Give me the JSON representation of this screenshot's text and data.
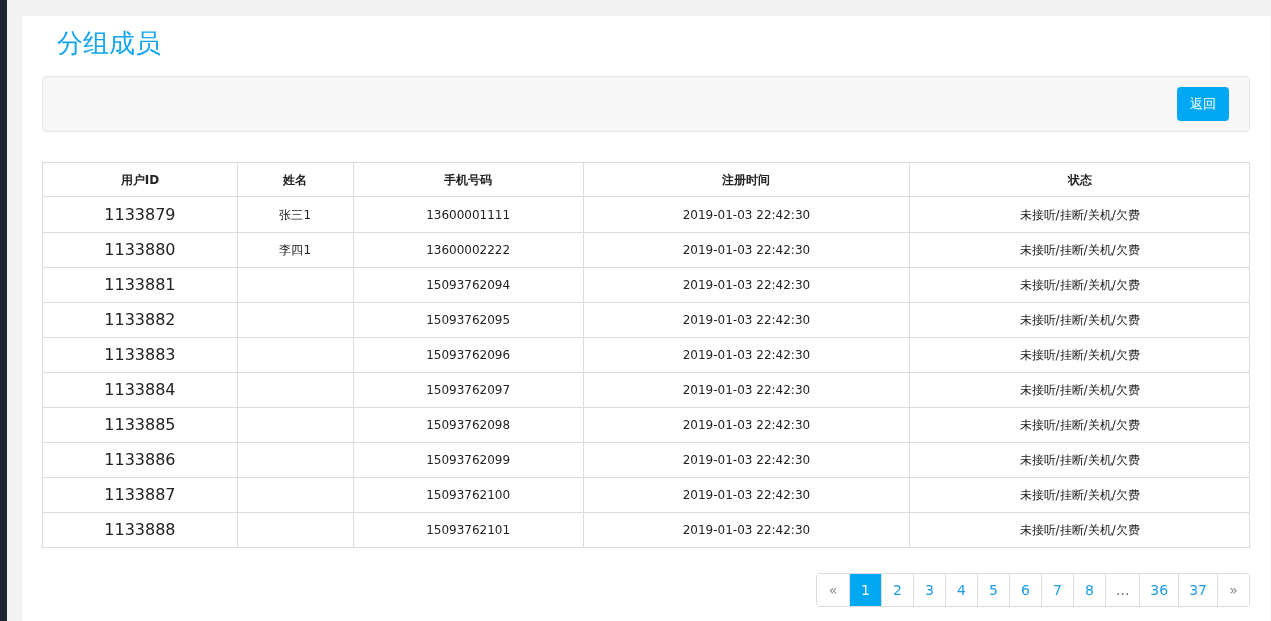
{
  "title": "分组成员",
  "toolbar": {
    "back_button": "返回"
  },
  "table": {
    "columns": [
      "用户ID",
      "姓名",
      "手机号码",
      "注册时间",
      "状态"
    ],
    "rows": [
      {
        "user_id": "1133879",
        "name": "张三1",
        "phone": "13600001111",
        "registered": "2019-01-03 22:42:30",
        "status": "未接听/挂断/关机/欠费"
      },
      {
        "user_id": "1133880",
        "name": "李四1",
        "phone": "13600002222",
        "registered": "2019-01-03 22:42:30",
        "status": "未接听/挂断/关机/欠费"
      },
      {
        "user_id": "1133881",
        "phone": "15093762094",
        "registered": "2019-01-03 22:42:30",
        "status": "未接听/挂断/关机/欠费"
      },
      {
        "user_id": "1133882",
        "phone": "15093762095",
        "registered": "2019-01-03 22:42:30",
        "status": "未接听/挂断/关机/欠费"
      },
      {
        "user_id": "1133883",
        "phone": "15093762096",
        "registered": "2019-01-03 22:42:30",
        "status": "未接听/挂断/关机/欠费"
      },
      {
        "user_id": "1133884",
        "phone": "15093762097",
        "registered": "2019-01-03 22:42:30",
        "status": "未接听/挂断/关机/欠费"
      },
      {
        "user_id": "1133885",
        "phone": "15093762098",
        "registered": "2019-01-03 22:42:30",
        "status": "未接听/挂断/关机/欠费"
      },
      {
        "user_id": "1133886",
        "phone": "15093762099",
        "registered": "2019-01-03 22:42:30",
        "status": "未接听/挂断/关机/欠费"
      },
      {
        "user_id": "1133887",
        "phone": "15093762100",
        "registered": "2019-01-03 22:42:30",
        "status": "未接听/挂断/关机/欠费"
      },
      {
        "user_id": "1133888",
        "phone": "15093762101",
        "registered": "2019-01-03 22:42:30",
        "status": "未接听/挂断/关机/欠费"
      }
    ]
  },
  "pagination": [
    {
      "label": "«",
      "kind": "nav",
      "selected": false
    },
    {
      "label": "1",
      "kind": "page",
      "selected": true
    },
    {
      "label": "2",
      "kind": "page",
      "selected": false
    },
    {
      "label": "3",
      "kind": "page",
      "selected": false
    },
    {
      "label": "4",
      "kind": "page",
      "selected": false
    },
    {
      "label": "5",
      "kind": "page",
      "selected": false
    },
    {
      "label": "6",
      "kind": "page",
      "selected": false
    },
    {
      "label": "7",
      "kind": "page",
      "selected": false
    },
    {
      "label": "8",
      "kind": "page",
      "selected": false
    },
    {
      "label": "...",
      "kind": "gap",
      "selected": false
    },
    {
      "label": "36",
      "kind": "page",
      "selected": false
    },
    {
      "label": "37",
      "kind": "page",
      "selected": false
    },
    {
      "label": "»",
      "kind": "nav",
      "selected": false
    }
  ]
}
